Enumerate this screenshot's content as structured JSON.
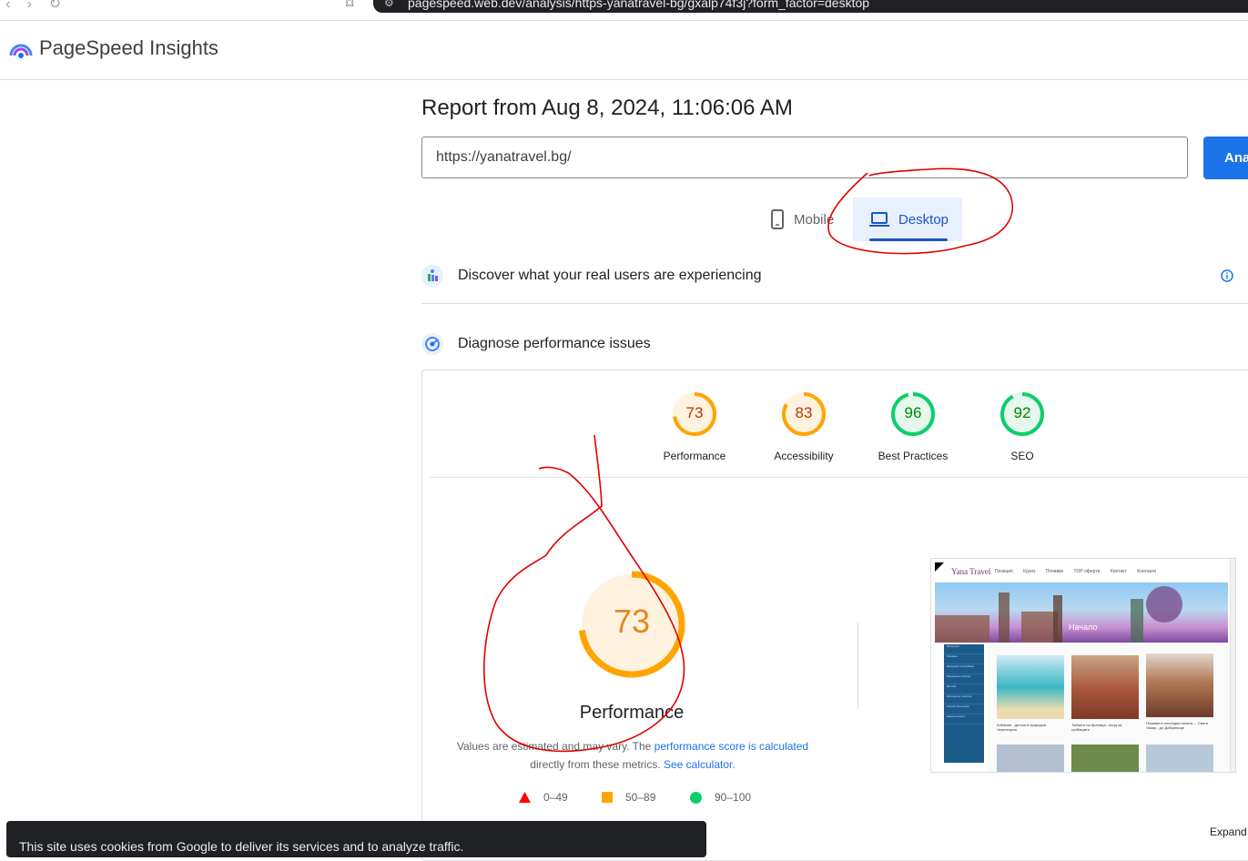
{
  "browser": {
    "url": "pagespeed.web.dev/analysis/https-yanatravel-bg/gxalp74f3j?form_factor=desktop"
  },
  "app": {
    "title": "PageSpeed Insights"
  },
  "report": {
    "title": "Report from Aug 8, 2024, 11:06:06 AM",
    "url_value": "https://yanatravel.bg/",
    "analyze_label": "Analyze"
  },
  "tabs": [
    {
      "label": "Mobile",
      "icon": "smartphone-icon",
      "selected": false
    },
    {
      "label": "Desktop",
      "icon": "laptop-icon",
      "selected": true
    }
  ],
  "sections": {
    "real_users": "Discover what your real users are experiencing",
    "diagnose": "Diagnose performance issues"
  },
  "scores": [
    {
      "label": "Performance",
      "value": 73,
      "color": "#e8871e"
    },
    {
      "label": "Accessibility",
      "value": 83,
      "color": "#e8871e"
    },
    {
      "label": "Best Practices",
      "value": 96,
      "color": "#0cce6b"
    },
    {
      "label": "SEO",
      "value": 92,
      "color": "#0cce6b"
    }
  ],
  "performance": {
    "score": "73",
    "label": "Performance",
    "note_prefix": "Values are estimated and may vary. The ",
    "note_link": "performance score is calculated",
    "note_middle": " directly from these metrics. ",
    "note_link2": "See calculator."
  },
  "legend": [
    {
      "range": "0–49",
      "shape": "triangle",
      "color": "#ff4e42"
    },
    {
      "range": "50–89",
      "shape": "square",
      "color": "#ffa400"
    },
    {
      "range": "90–100",
      "shape": "circle",
      "color": "#0cce6b"
    }
  ],
  "thumbnail": {
    "brand": "Yana Travel",
    "menu": [
      "Позиция",
      "Круиз",
      "Почивки",
      "TOP оферти",
      "Контакт",
      "Контакти"
    ],
    "hero_title": "Начало",
    "sidebar": [
      "Екскурзии",
      "Почивки",
      "Екскурзии в Чужбина",
      "Ежедневни обзори",
      "Фестив",
      "Интересни събития",
      "Контакт България",
      "Ежекатегории"
    ],
    "captions": [
      "Албания - детска и природна Черногория",
      "Тайните на Кралица - вход на гробищата",
      "Почивки в последни посети-... Свети Лазар - до Добринище"
    ]
  },
  "cookie": {
    "text": "This site uses cookies from Google to deliver its services and to analyze traffic."
  },
  "expand": {
    "label": "Expand"
  }
}
